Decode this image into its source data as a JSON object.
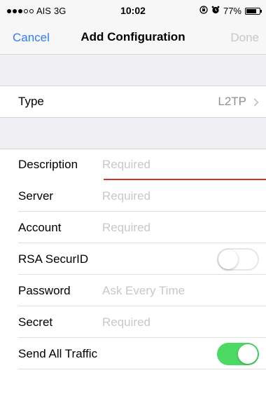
{
  "status_bar": {
    "signal_full": 3,
    "signal_empty": 2,
    "carrier": "AIS",
    "network": "3G",
    "time": "10:02",
    "icons": [
      "lock-rotation-icon",
      "alarm-icon"
    ],
    "battery_percent": "77%",
    "battery_level": 0.77
  },
  "nav": {
    "cancel_label": "Cancel",
    "title": "Add Configuration",
    "done_label": "Done"
  },
  "type_row": {
    "label": "Type",
    "value": "L2TP"
  },
  "fields": {
    "description": {
      "label": "Description",
      "placeholder": "Required"
    },
    "server": {
      "label": "Server",
      "placeholder": "Required"
    },
    "account": {
      "label": "Account",
      "placeholder": "Required"
    },
    "rsa": {
      "label": "RSA SecurID",
      "on": false
    },
    "password": {
      "label": "Password",
      "placeholder": "Ask Every Time"
    },
    "secret": {
      "label": "Secret",
      "placeholder": "Required"
    },
    "send_all": {
      "label": "Send All Traffic",
      "on": true
    }
  },
  "colors": {
    "accent": "#2f7cf6",
    "switch_on": "#4cd964",
    "focus_underline": "#d9301f",
    "group_background": "#efeff4"
  }
}
